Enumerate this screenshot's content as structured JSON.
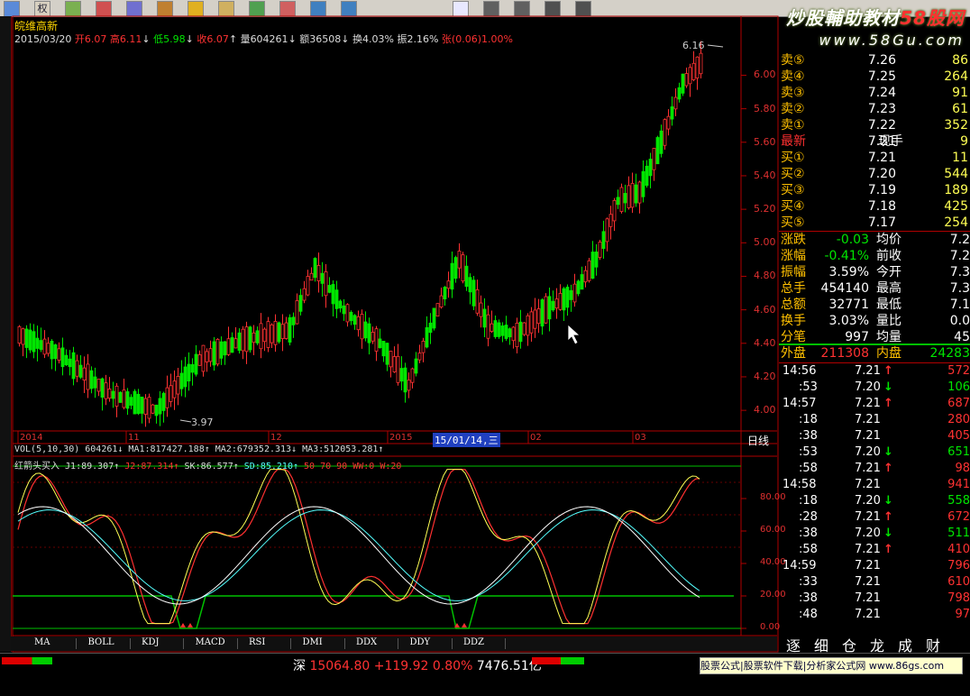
{
  "watermark": {
    "line1_a": "炒股輔助教材",
    "line1_b": "58股网",
    "line2": "www.58Gu.com"
  },
  "toolbar": {
    "icons": [
      "move-icon",
      "rights-icon",
      "chart-icon",
      "indicator-icon",
      "window-icon",
      "draw-icon",
      "alert-icon",
      "folder-icon",
      "up-icon",
      "down-icon",
      "zoom-in-icon",
      "zoom-out-icon",
      "cursor-icon",
      "line-tool-icon",
      "bar-tool-icon",
      "sort-icon",
      "anchor-icon"
    ],
    "rights_label": "权"
  },
  "header": {
    "stock_name": "皖维高新",
    "date": "2015/03/20",
    "open_label": "开",
    "open": "6.07",
    "high_label": "高",
    "high": "6.11",
    "low_label": "低",
    "low": "5.98",
    "close_label": "收",
    "close": "6.07",
    "vol_label": "量",
    "volume": "604261",
    "amt_label": "额",
    "amount": "36508",
    "turn_label": "换",
    "turnover": "4.03%",
    "amp_label": "振",
    "amplitude": "2.16%",
    "chg_label": "张",
    "change": "(0.06)",
    "pct": "1.00%"
  },
  "price_axis": {
    "ticks": [
      "6.00",
      "5.80",
      "5.60",
      "5.40",
      "5.20",
      "5.00",
      "4.80",
      "4.60",
      "4.40",
      "4.20",
      "4.00"
    ],
    "min": 3.92,
    "max": 6.18
  },
  "high_marker": "6.16",
  "low_marker": "3.97",
  "date_axis": {
    "labels": [
      "2014",
      "11",
      "12",
      "2015",
      "02",
      "03"
    ],
    "cursor_date": "15/01/14,三",
    "period": "日线"
  },
  "volume_row": {
    "text": "VOL(5,10,30) 604261↓ MA1:817427.188↑ MA2:679352.313↓ MA3:512053.281↑"
  },
  "indicator": {
    "name": "红箭头买入",
    "j1": "J1:89.307↑",
    "j2": "J2:87.314↑",
    "sk": "SK:86.577↑",
    "sd": "SD:85.210↑",
    "levels": "50 70 90 WW:0 W:20",
    "axis": [
      "80.00",
      "60.00",
      "40.00",
      "20.00",
      "0.00"
    ]
  },
  "bottom_tabs": [
    "MA",
    "BOLL",
    "KDJ",
    "MACD",
    "RSI",
    "DMI",
    "DDX",
    "DDY",
    "DDZ"
  ],
  "right_tabs": [
    "逐",
    "细",
    "仓",
    "龙",
    "成",
    "财"
  ],
  "orderbook": {
    "asks": [
      {
        "label": "卖⑤",
        "price": "7.26",
        "vol": "86"
      },
      {
        "label": "卖④",
        "price": "7.25",
        "vol": "264"
      },
      {
        "label": "卖③",
        "price": "7.24",
        "vol": "91"
      },
      {
        "label": "卖②",
        "price": "7.23",
        "vol": "61"
      },
      {
        "label": "卖①",
        "price": "7.22",
        "vol": "352"
      }
    ],
    "latest": {
      "label": "最新",
      "price": "7.21",
      "label2": "现手",
      "vol": "9"
    },
    "bids": [
      {
        "label": "买①",
        "price": "7.21",
        "vol": "11"
      },
      {
        "label": "买②",
        "price": "7.20",
        "vol": "544"
      },
      {
        "label": "买③",
        "price": "7.19",
        "vol": "189"
      },
      {
        "label": "买④",
        "price": "7.18",
        "vol": "425"
      },
      {
        "label": "买⑤",
        "price": "7.17",
        "vol": "254"
      }
    ],
    "stats": [
      {
        "l1": "涨跌",
        "v1": "-0.03",
        "l2": "均价",
        "v2": "7.2"
      },
      {
        "l1": "涨幅",
        "v1": "-0.41%",
        "l2": "前收",
        "v2": "7.2"
      },
      {
        "l1": "振幅",
        "v1": "3.59%",
        "l2": "今开",
        "v2": "7.3"
      },
      {
        "l1": "总手",
        "v1": "454140",
        "l2": "最高",
        "v2": "7.3"
      },
      {
        "l1": "总额",
        "v1": "32771",
        "l2": "最低",
        "v2": "7.1"
      },
      {
        "l1": "换手",
        "v1": "3.03%",
        "l2": "量比",
        "v2": "0.0"
      },
      {
        "l1": "分笔",
        "v1": "997",
        "l2": "均量",
        "v2": "45"
      }
    ],
    "outer_label": "外盘",
    "outer": "211308",
    "inner_label": "内盘",
    "inner": "24283"
  },
  "trades": [
    {
      "time": "14:56",
      "price": "7.21",
      "dir": "up",
      "vol": "572"
    },
    {
      "time": ":53",
      "price": "7.20",
      "dir": "down",
      "vol": "106"
    },
    {
      "time": "14:57",
      "price": "7.21",
      "dir": "up",
      "vol": "687"
    },
    {
      "time": ":18",
      "price": "7.21",
      "dir": "",
      "vol": "280"
    },
    {
      "time": ":38",
      "price": "7.21",
      "dir": "",
      "vol": "405"
    },
    {
      "time": ":53",
      "price": "7.20",
      "dir": "down",
      "vol": "651"
    },
    {
      "time": ":58",
      "price": "7.21",
      "dir": "up",
      "vol": "98"
    },
    {
      "time": "14:58",
      "price": "7.21",
      "dir": "",
      "vol": "941"
    },
    {
      "time": ":18",
      "price": "7.20",
      "dir": "down",
      "vol": "558"
    },
    {
      "time": ":28",
      "price": "7.21",
      "dir": "up",
      "vol": "672"
    },
    {
      "time": ":38",
      "price": "7.20",
      "dir": "down",
      "vol": "511"
    },
    {
      "time": ":58",
      "price": "7.21",
      "dir": "up",
      "vol": "410"
    },
    {
      "time": "14:59",
      "price": "7.21",
      "dir": "",
      "vol": "796"
    },
    {
      "time": ":33",
      "price": "7.21",
      "dir": "",
      "vol": "610"
    },
    {
      "time": ":38",
      "price": "7.21",
      "dir": "",
      "vol": "798"
    },
    {
      "time": ":48",
      "price": "7.21",
      "dir": "",
      "vol": "97"
    }
  ],
  "status": {
    "market": "深",
    "index": "15064.80",
    "change": "+119.92",
    "pct": "0.80%",
    "turnover": "7476.51亿",
    "ad": "股票公式|股票软件下载|分析家公式网 www.86gs.com"
  },
  "colors": {
    "up": "#ff3232",
    "down": "#00e600",
    "axis_red": "#b00000",
    "yellow": "#ffff54",
    "cyan": "#54ffff",
    "label_gold": "#ffc000"
  }
}
